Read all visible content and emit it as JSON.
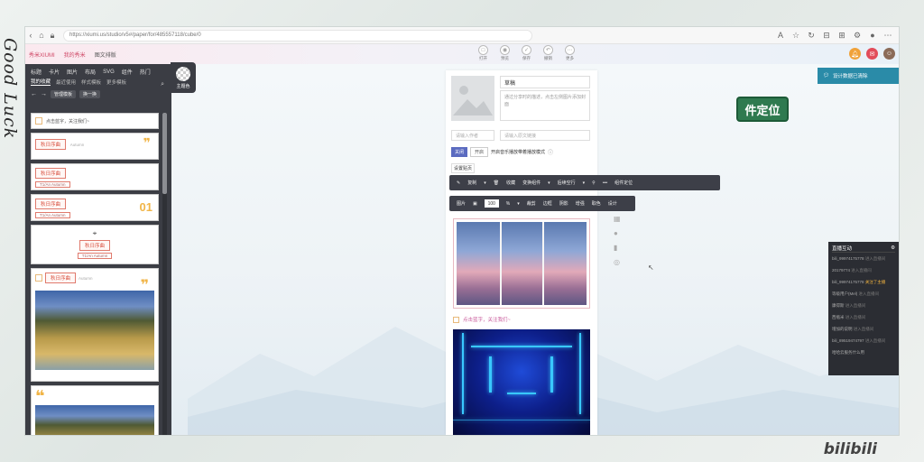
{
  "decor": {
    "left_handwriting": "Good Luck",
    "brand": "bilibili"
  },
  "browser": {
    "url": "https://xiumi.us/studio/v5#/paper/for/485557118/cube/0"
  },
  "app_header": {
    "links": [
      "秀米XIUMI",
      "我的秀米",
      "图文排版"
    ],
    "tools": [
      {
        "icon": "open-icon",
        "label": "打开"
      },
      {
        "icon": "preview-icon",
        "label": "预览"
      },
      {
        "icon": "save-icon",
        "label": "保存"
      },
      {
        "icon": "undo-icon",
        "label": "撤销"
      },
      {
        "icon": "more-icon",
        "label": "更多"
      }
    ]
  },
  "left_panel": {
    "categories": [
      "标题",
      "卡片",
      "图片",
      "布局",
      "SVG",
      "组件",
      "热门"
    ],
    "subtabs": [
      "我的收藏",
      "最近使用",
      "样式模板",
      "更多模板"
    ],
    "active_subtab": "我的收藏",
    "actions": {
      "prev": "←",
      "next": "→",
      "manage": "管理模板",
      "swap": "换一换"
    },
    "theme_label": "主题色",
    "templates": [
      {
        "kind": "follow",
        "text": "点击蓝字，关注我们~"
      },
      {
        "kind": "title",
        "title": "秋日序曲",
        "subtitle": "Autumn"
      },
      {
        "kind": "title-en",
        "title": "秋日序曲",
        "subtitle": "T1/An Autumn"
      },
      {
        "kind": "title-num",
        "title": "秋日序曲",
        "subtitle": "T1/An Autumn",
        "num": "01"
      },
      {
        "kind": "title-pin",
        "title": "秋日序曲",
        "subtitle": "T1/An Autumn"
      },
      {
        "kind": "title-photo",
        "title": "秋日序曲",
        "subtitle": "Autumn"
      },
      {
        "kind": "quote-photo"
      }
    ]
  },
  "editor": {
    "title_value": "草稿",
    "abstract_placeholder": "通过分享时的描述，点击左侧图片添加封面",
    "author_placeholder": "请输入作者",
    "source_placeholder": "请输入原文链接",
    "toggle_off": "关闭",
    "toggle_on": "开启",
    "toggle_label": "开启音乐播放带着播放模式",
    "setting_label": "设置贴页",
    "follow_text": "点击蓝字，关注我们~"
  },
  "toolbar1": {
    "copy": "复制",
    "fav": "收藏",
    "swap": "变换组件",
    "scroll": "后续空行",
    "locate": "组件定位"
  },
  "toolbar2": {
    "image": "图片",
    "percent": "100",
    "percent_unit": "%",
    "crop": "裁剪",
    "border": "边框",
    "shadow": "阴影",
    "enhance": "增强",
    "pick": "取色",
    "design": "设计"
  },
  "locate_tag": "件定位",
  "tip": "设计数据已清除",
  "chat": {
    "title": "直播互动",
    "rows": [
      {
        "user": "bili_99974175778",
        "action": "进入直播间",
        "hl": false
      },
      {
        "user": "20179774",
        "action": "进入直播间",
        "hl": false
      },
      {
        "user": "bili_99974175778",
        "action": "关注了主播",
        "hl": true
      },
      {
        "user": "等级用户(Mel)",
        "action": "进入直播间",
        "hl": false
      },
      {
        "user": "康得斯",
        "action": "进入直播间",
        "hl": false
      },
      {
        "user": "西瓶米",
        "action": "进入直播间",
        "hl": false
      },
      {
        "user": "增加的说明",
        "action": "进入直播间",
        "hl": false
      },
      {
        "user": "bili_89519474797",
        "action": "进入直播间",
        "hl": false
      },
      {
        "user": "哈哈云服务什么用",
        "action": "",
        "hl": false
      }
    ]
  }
}
